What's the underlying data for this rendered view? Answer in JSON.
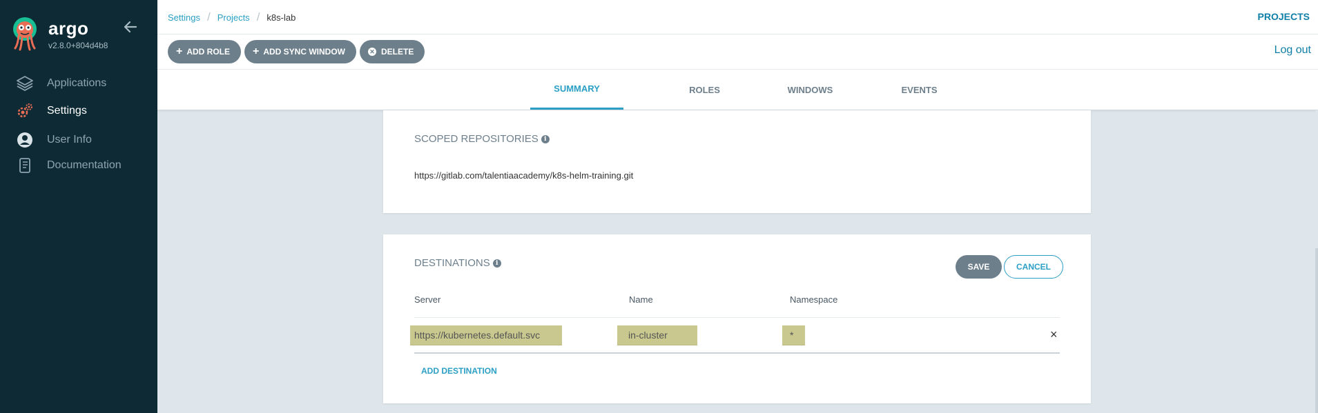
{
  "sidebar": {
    "brand": "argo",
    "version": "v2.8.0+804d4b8",
    "items": [
      {
        "label": "Applications",
        "icon": "layers-icon"
      },
      {
        "label": "Settings",
        "icon": "gears-icon"
      },
      {
        "label": "User Info",
        "icon": "user-circle-icon"
      },
      {
        "label": "Documentation",
        "icon": "book-icon"
      }
    ],
    "active_item": "Settings"
  },
  "breadcrumb": [
    "Settings",
    "Projects",
    "k8s-lab"
  ],
  "header": {
    "projects_label": "PROJECTS",
    "logout_label": "Log out"
  },
  "toolbar": {
    "add_role": "ADD ROLE",
    "add_sync_window": "ADD SYNC WINDOW",
    "delete": "DELETE"
  },
  "tabs": [
    "SUMMARY",
    "ROLES",
    "WINDOWS",
    "EVENTS"
  ],
  "active_tab": "SUMMARY",
  "repositories": {
    "title": "SCOPED REPOSITORIES",
    "items": [
      "https://gitlab.com/talentiaacademy/k8s-helm-training.git"
    ]
  },
  "destinations": {
    "title": "DESTINATIONS",
    "save_label": "SAVE",
    "cancel_label": "CANCEL",
    "columns": [
      "Server",
      "Name",
      "Namespace"
    ],
    "rows": [
      {
        "server": "https://kubernetes.default.svc",
        "name": "in-cluster",
        "namespace": "*"
      }
    ],
    "add_label": "ADD DESTINATION"
  },
  "colors": {
    "sidebar_bg": "#0e2b35",
    "accent": "#2b9fc5",
    "button_gray": "#6d7f8b",
    "highlight": "#c8c88f",
    "logo_orange": "#e96d55"
  }
}
